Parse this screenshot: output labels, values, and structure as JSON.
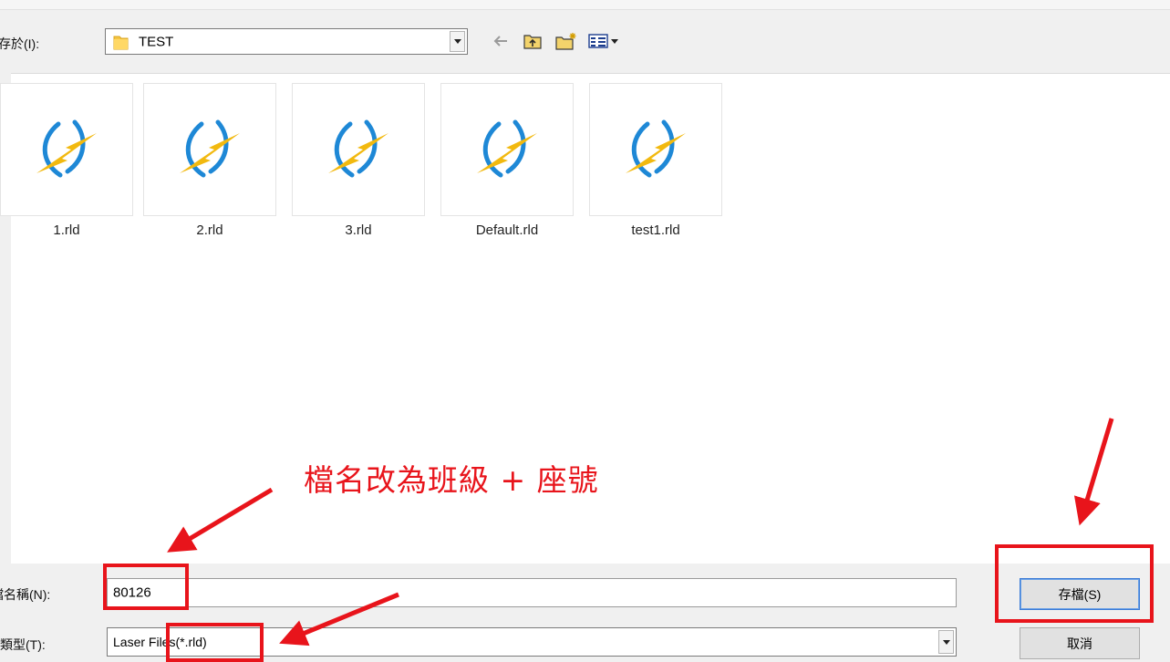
{
  "dialog": {
    "save_in_label": "存於(I):",
    "folder_combo": {
      "value": "TEST"
    },
    "toolbar": [
      "back-icon",
      "up-folder-icon",
      "new-folder-icon",
      "view-menu-icon"
    ],
    "files": [
      {
        "name": "1.rld",
        "icon": "rld-laser-file-icon"
      },
      {
        "name": "2.rld",
        "icon": "rld-laser-file-icon"
      },
      {
        "name": "3.rld",
        "icon": "rld-laser-file-icon"
      },
      {
        "name": "Default.rld",
        "icon": "rld-laser-file-icon"
      },
      {
        "name": "test1.rld",
        "icon": "rld-laser-file-icon"
      }
    ],
    "filename_label": "檔名稱(N):",
    "filename_value": "80126",
    "filetype_label": "存檔類型(T):",
    "filetype_value": "Laser Files(*.rld)",
    "save_button": "存檔(S)",
    "cancel_button": "取消"
  },
  "annotation": {
    "text": "檔名改為班級 + 座號",
    "color": "#e8141b"
  }
}
